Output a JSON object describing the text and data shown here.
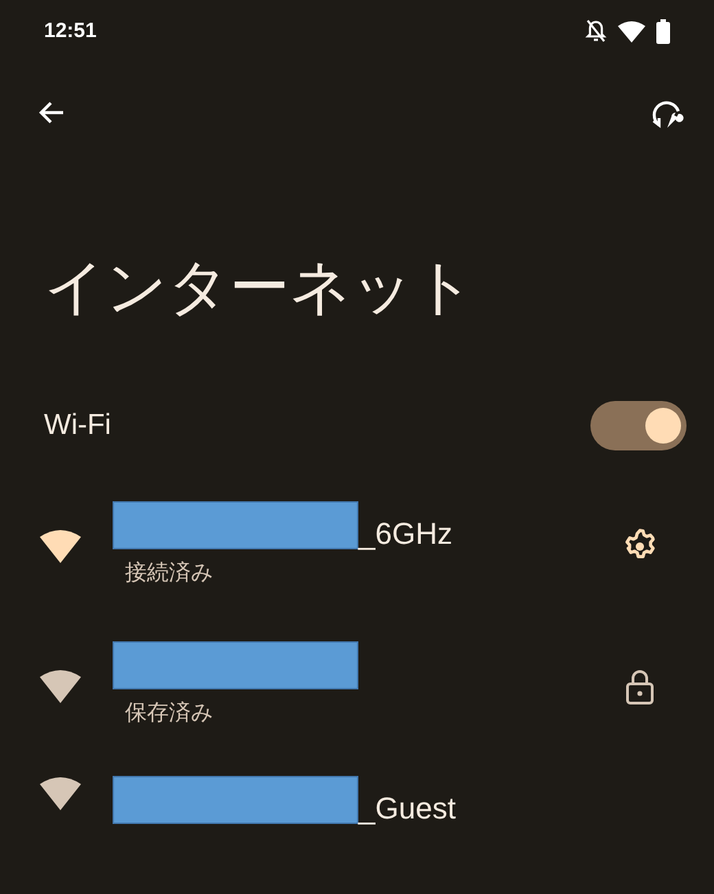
{
  "status_bar": {
    "time": "12:51"
  },
  "title": "インターネット",
  "wifi": {
    "label": "Wi-Fi",
    "on": true
  },
  "networks": [
    {
      "name": "_6GHz",
      "redacted": true,
      "status": "接続済み",
      "connected": true,
      "kind": "settings"
    },
    {
      "redacted": true,
      "status": "保存済み",
      "connected": false,
      "kind": "locked"
    },
    {
      "name": "_Guest",
      "redacted": true,
      "connected": false,
      "kind": "plain"
    }
  ]
}
